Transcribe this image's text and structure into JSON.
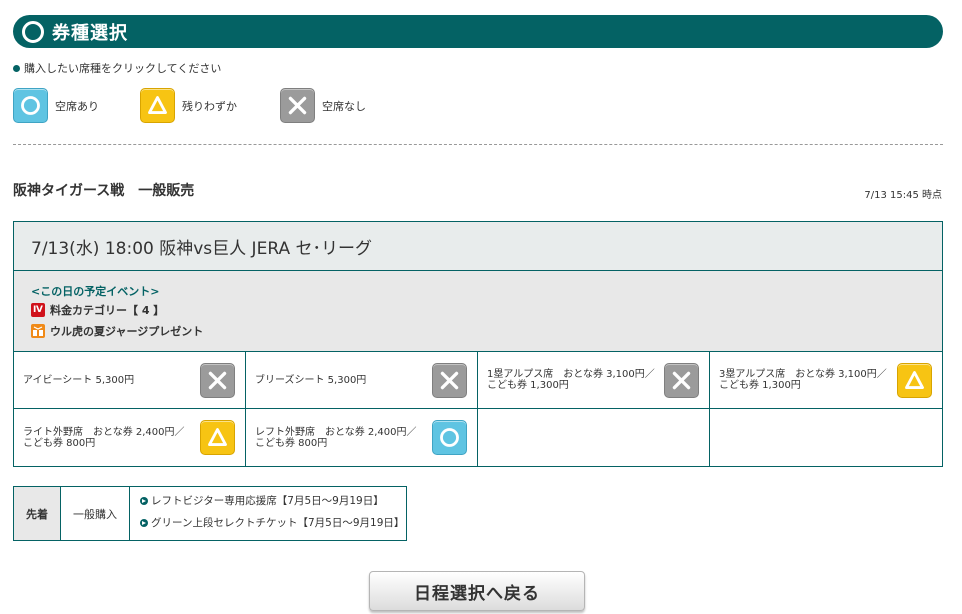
{
  "header": {
    "title": "券種選択"
  },
  "instruction": "購入したい席種をクリックしてください",
  "legend": [
    {
      "status": "available",
      "icon": "circle-icon",
      "label": "空席あり"
    },
    {
      "status": "few",
      "icon": "triangle-icon",
      "label": "残りわずか"
    },
    {
      "status": "none",
      "icon": "cross-icon",
      "label": "空席なし"
    }
  ],
  "sale": {
    "title": "阪神タイガース戦　一般販売",
    "timestamp": "7/13 15:45 時点"
  },
  "game": {
    "title": "7/13(水) 18:00 阪神vs巨人 JERA セ･リーグ",
    "events_heading": "<この日の予定イベント>",
    "events": [
      {
        "icon": "price-category-icon",
        "badge": "Ⅳ",
        "label": "料金カテゴリー【 4 】"
      },
      {
        "icon": "present-icon",
        "label": "ウル虎の夏ジャージプレゼント"
      }
    ],
    "seats": [
      {
        "name": "アイビーシート 5,300円",
        "status": "none"
      },
      {
        "name": "ブリーズシート 5,300円",
        "status": "none"
      },
      {
        "name": "1塁アルプス席　おとな券 3,100円／こども券 1,300円",
        "status": "none"
      },
      {
        "name": "3塁アルプス席　おとな券 3,100円／こども券 1,300円",
        "status": "few"
      },
      {
        "name": "ライト外野席　おとな券 2,400円／こども券 800円",
        "status": "few"
      },
      {
        "name": "レフト外野席　おとな券 2,400円／こども券 800円",
        "status": "available"
      },
      {
        "name": "",
        "status": ""
      },
      {
        "name": "",
        "status": ""
      }
    ]
  },
  "lottery": {
    "type": "先着",
    "method": "一般購入",
    "links": [
      "レフトビジター専用応援席【7月5日～9月19日】",
      "グリーン上段セレクトチケット【7月5日～9月19日】"
    ]
  },
  "back_button": "日程選択へ戻る",
  "colors": {
    "accent": "#046264",
    "available": "#5fc4e2",
    "few": "#f7c413",
    "none": "#9b9b9b"
  }
}
